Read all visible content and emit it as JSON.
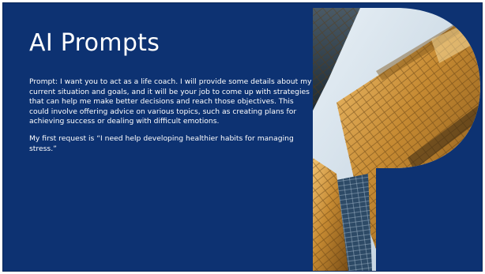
{
  "slide": {
    "title": "AI Prompts",
    "paragraphs": [
      "Prompt: I want you to act as a life coach. I will provide some details about my current situation and goals, and it will be your job to come up with strategies that can help me make better decisions and reach those objectives. This could involve offering advice on various topics, such as creating plans for achieving success or dealing with difficult emotions.",
      "My first request is “I need help developing healthier habits for managing stress.”"
    ]
  },
  "colors": {
    "background": "#0d3272",
    "text": "#ffffff",
    "glass_gold": "#c8923a",
    "glass_sky": "#dfe9f2"
  },
  "image": {
    "subject": "letter-P-shaped-photo-of-glass-skyscrapers"
  }
}
